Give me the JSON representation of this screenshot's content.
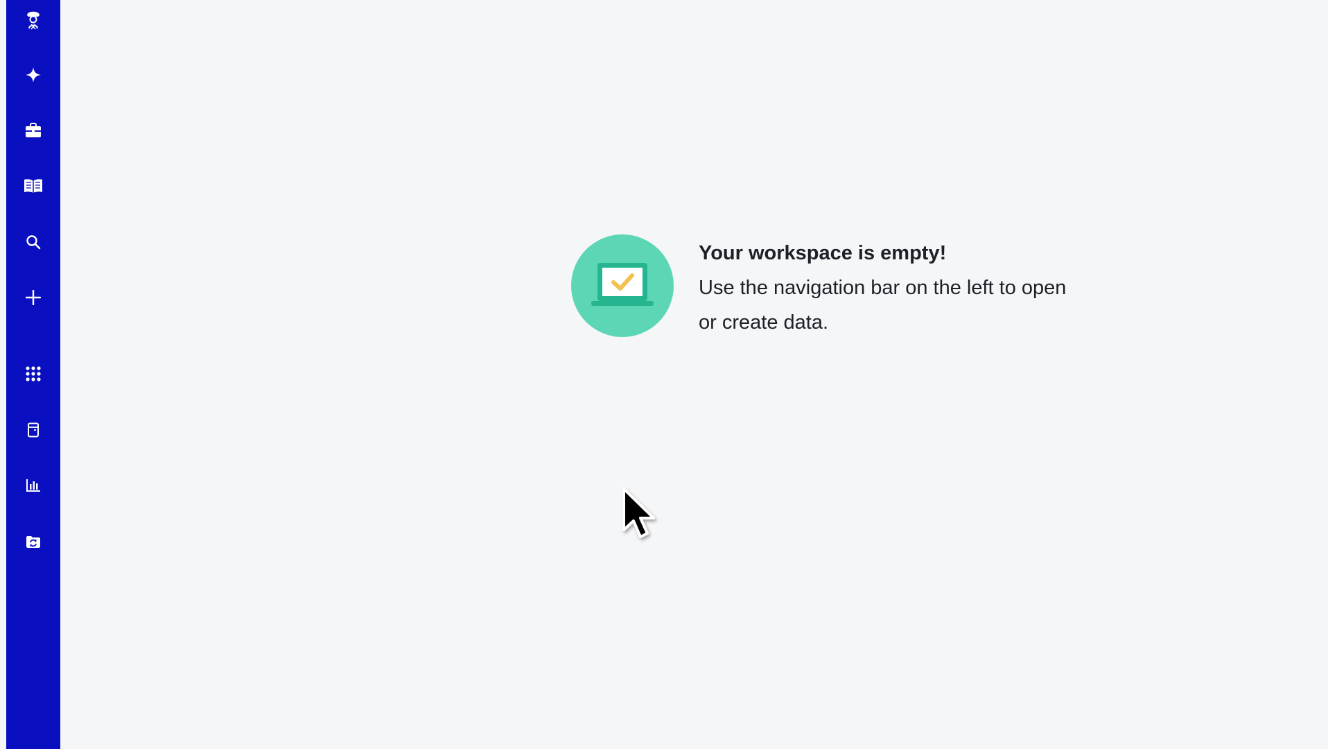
{
  "sidebar": {
    "background": "#0a0fbf",
    "icons": [
      "user-avatar-icon",
      "sparkle-icon",
      "briefcase-icon",
      "book-icon",
      "search-icon",
      "plus-icon",
      "apps-grid-icon",
      "notebook-icon",
      "bar-chart-icon",
      "folder-sync-icon"
    ]
  },
  "empty_state": {
    "title": "Your workspace is empty!",
    "description": "Use the navigation bar on the left to open or create data.",
    "illustration_color": "#5cd6b5",
    "illustration_icon": "laptop-check-icon"
  },
  "colors": {
    "background": "#f5f6f8",
    "text": "#1f2027",
    "check": "#f2c14e"
  }
}
